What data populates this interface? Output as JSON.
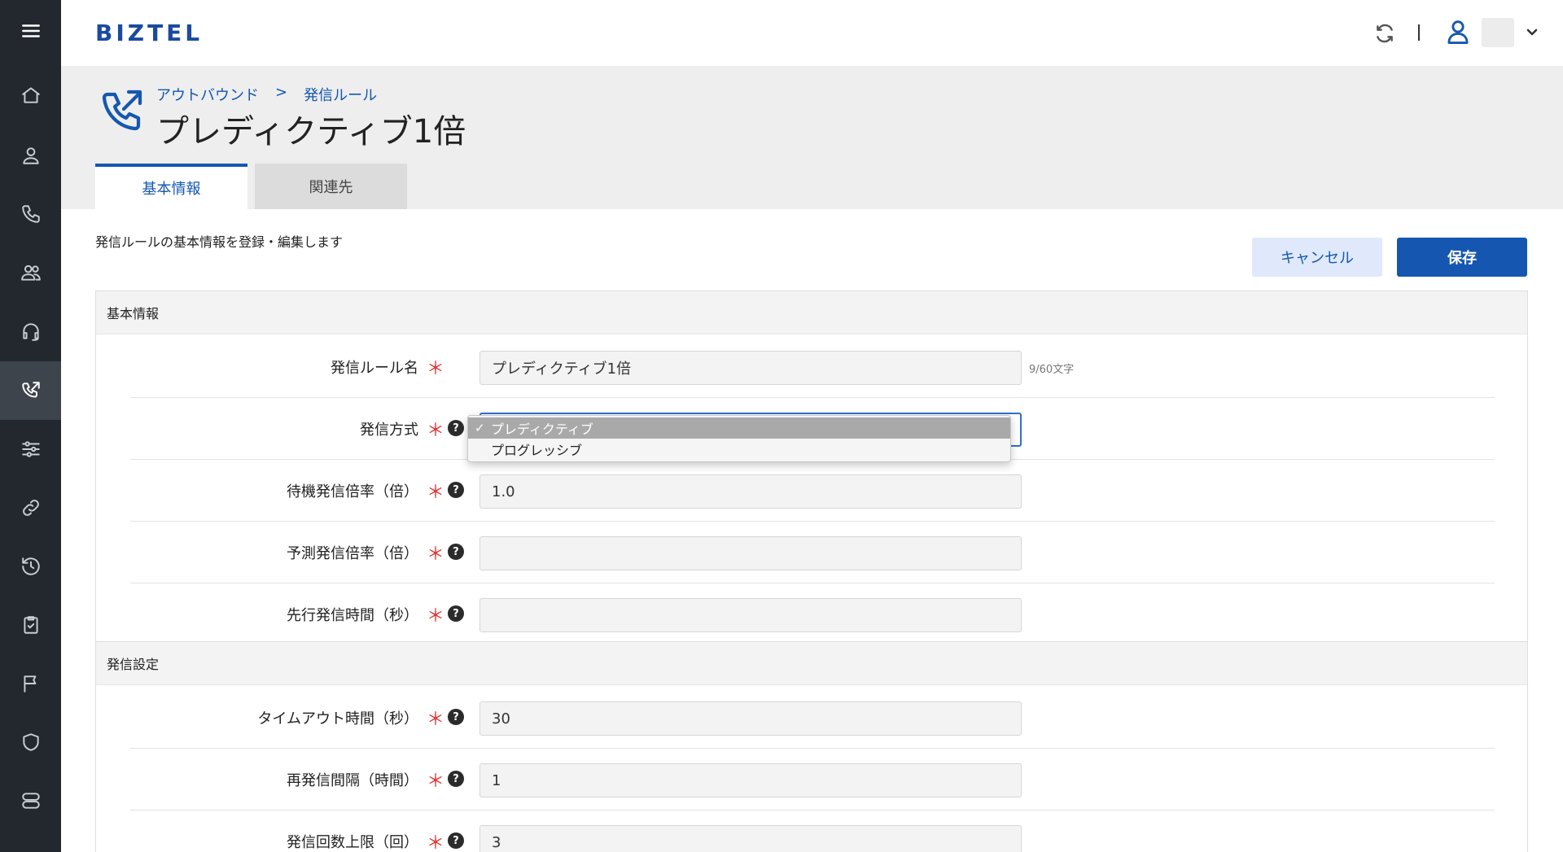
{
  "app": {
    "logo": "BIZTEL"
  },
  "sidebar": {
    "items": [
      {
        "name": "home",
        "icon": "home-icon"
      },
      {
        "name": "user",
        "icon": "user-icon"
      },
      {
        "name": "phone",
        "icon": "phone-icon"
      },
      {
        "name": "group",
        "icon": "group-icon"
      },
      {
        "name": "headset",
        "icon": "headset-icon"
      },
      {
        "name": "outbound",
        "icon": "outbound-call-icon",
        "active": true
      },
      {
        "name": "settings",
        "icon": "sliders-icon"
      },
      {
        "name": "link",
        "icon": "link-icon"
      },
      {
        "name": "history",
        "icon": "history-icon"
      },
      {
        "name": "tasks",
        "icon": "checklist-icon"
      },
      {
        "name": "flag",
        "icon": "flag-icon"
      },
      {
        "name": "security",
        "icon": "shield-icon"
      },
      {
        "name": "server",
        "icon": "server-icon"
      }
    ]
  },
  "header": {
    "breadcrumb": [
      "アウトバウンド",
      ">",
      "発信ルール"
    ],
    "title": "プレディクティブ1倍",
    "tabs": [
      {
        "label": "基本情報",
        "active": true
      },
      {
        "label": "関連先",
        "active": false
      }
    ]
  },
  "main": {
    "description": "発信ルールの基本情報を登録・編集します",
    "cancel_label": "キャンセル",
    "save_label": "保存",
    "sections": [
      {
        "title": "基本情報",
        "fields": [
          {
            "label": "発信ルール名",
            "required": true,
            "help": false,
            "value": "プレディクティブ1倍",
            "counter": "9/60文字"
          },
          {
            "label": "発信方式",
            "required": true,
            "help": true,
            "value": "プレディクティブ",
            "type": "select"
          },
          {
            "label": "待機発信倍率（倍）",
            "required": true,
            "help": true,
            "value": "1.0"
          },
          {
            "label": "予測発信倍率（倍）",
            "required": true,
            "help": true,
            "value": ""
          },
          {
            "label": "先行発信時間（秒）",
            "required": true,
            "help": true,
            "value": ""
          }
        ]
      },
      {
        "title": "発信設定",
        "fields": [
          {
            "label": "タイムアウト時間（秒）",
            "required": true,
            "help": true,
            "value": "30"
          },
          {
            "label": "再発信間隔（時間）",
            "required": true,
            "help": true,
            "value": "1"
          },
          {
            "label": "発信回数上限（回）",
            "required": true,
            "help": true,
            "value": "3"
          }
        ]
      }
    ],
    "dropdown": {
      "options": [
        "プレディクティブ",
        "プログレッシブ"
      ],
      "selected": "プレディクティブ"
    }
  },
  "ui": {
    "required_mark": "＊",
    "help_mark": "?",
    "check_mark": "✓"
  },
  "colors": {
    "accent": "#1557b0",
    "sidebar_bg": "#23282e",
    "required": "#d33333"
  }
}
